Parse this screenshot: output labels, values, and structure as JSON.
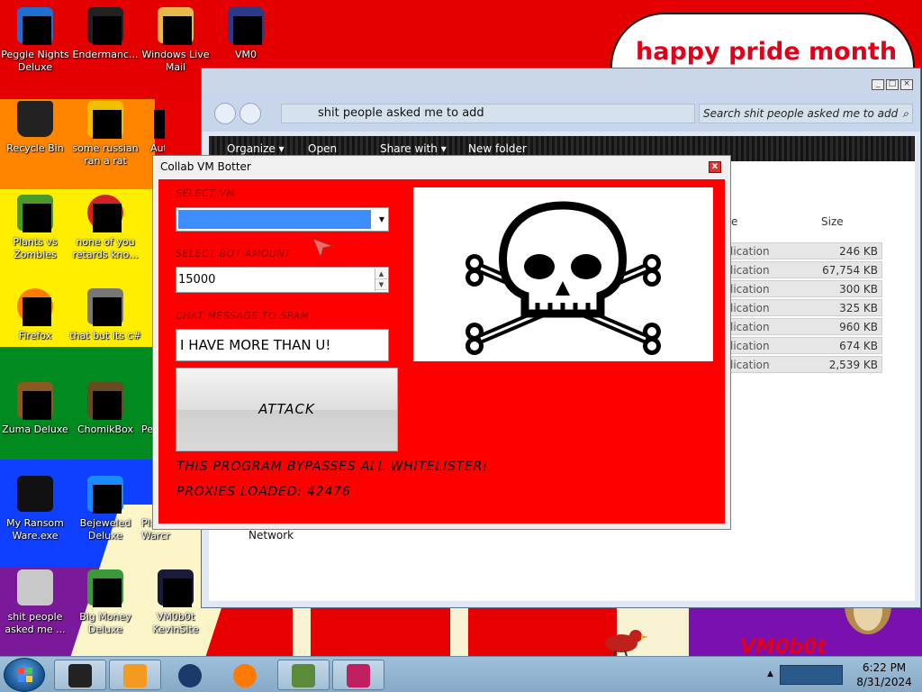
{
  "wallpaper": {
    "banner_text": "happy pride month",
    "brand_text": "VM0b0t"
  },
  "desktop_icons": [
    {
      "label": "Peggle Nights Deluxe",
      "icon": "peggle-icon",
      "color": "#1e6fd0"
    },
    {
      "label": "Endermanc...",
      "icon": "terminal-icon",
      "color": "#222222"
    },
    {
      "label": "Windows Live Mail",
      "icon": "mail-folder-icon",
      "color": "#e7b84a"
    },
    {
      "label": "VM0",
      "icon": "vm-icon",
      "color": "#2a3a8a"
    },
    {
      "label": "Recycle Bin",
      "icon": "recycle-bin-icon",
      "color": "#222222"
    },
    {
      "label": "some russian ran a rat",
      "icon": "ie-icon",
      "color": "#f0c000"
    },
    {
      "label": "Plants vs Zombies",
      "icon": "plant-icon",
      "color": "#4a9a2a"
    },
    {
      "label": "none of you retards kno...",
      "icon": "red-disc-icon",
      "color": "#d32020"
    },
    {
      "label": "Firefox",
      "icon": "firefox-icon",
      "color": "#ff7a00"
    },
    {
      "label": "that but its c#",
      "icon": "stack-icon",
      "color": "#777777"
    },
    {
      "label": "Zuma Deluxe",
      "icon": "zuma-icon",
      "color": "#8a5a20"
    },
    {
      "label": "ChomikBox",
      "icon": "chomik-icon",
      "color": "#6a4a20"
    },
    {
      "label": "My Ransom Ware.exe",
      "icon": "program-icon",
      "color": "#111111"
    },
    {
      "label": "Bejeweled Deluxe",
      "icon": "gem-icon",
      "color": "#1a8aff"
    },
    {
      "label": "shit people asked me ...",
      "icon": "folder-icon",
      "color": "#c8c8c8"
    },
    {
      "label": "Big Money Deluxe",
      "icon": "money-icon",
      "color": "#3a9a3a"
    },
    {
      "label": "VM0b0t KevinSite",
      "icon": "monitor-icon",
      "color": "#1a1a3a"
    }
  ],
  "partial_icon_labels": {
    "right_of_ie": "Auto F",
    "right_of_chomik": "Pe",
    "right_of_bejeweled": "Play of Warcr"
  },
  "explorer": {
    "address": "shit people asked me to add",
    "search_placeholder": "Search shit people asked me to add",
    "toolbar": [
      "Organize ▾",
      "Open",
      "Share with ▾",
      "New folder"
    ],
    "columns": {
      "type": "e",
      "size": "Size"
    },
    "files": [
      {
        "type": "lication",
        "size": "246 KB"
      },
      {
        "type": "lication",
        "size": "67,754 KB"
      },
      {
        "type": "lication",
        "size": "300 KB"
      },
      {
        "type": "lication",
        "size": "325 KB"
      },
      {
        "type": "lication",
        "size": "960 KB"
      },
      {
        "type": "lication",
        "size": "674 KB"
      },
      {
        "type": "lication",
        "size": "2,539 KB"
      }
    ],
    "nav_network": "Network"
  },
  "botter": {
    "title": "Collab VM Botter",
    "close": "x",
    "select_vm_label": "SELECT VM",
    "select_vm_value": "",
    "bot_amount_label": "SELECT BOT AMOUNT",
    "bot_amount_value": "15000",
    "chat_label": "CHAT MESSAGE TO SPAM",
    "chat_value": "I HAVE MORE THAN U!",
    "attack_label": "ATTACK",
    "note_bypass": "THIS PROGRAM BYPASSES ALL WHITELISTER!",
    "note_proxies": "PROXIES LOADED: 42476",
    "image_icon": "skull-crossbones-icon"
  },
  "taskbar": {
    "apps": [
      {
        "icon": "program-icon",
        "color": "#222222"
      },
      {
        "icon": "media-player-icon",
        "color": "#f39a20"
      },
      {
        "icon": "globe-icon",
        "color": "#1a3a6a"
      },
      {
        "icon": "firefox-icon",
        "color": "#ff7a00"
      },
      {
        "icon": "minecraft-icon",
        "color": "#5a8a3a"
      },
      {
        "icon": "image-viewer-icon",
        "color": "#c02060"
      }
    ],
    "time": "6:22 PM",
    "date": "8/31/2024"
  }
}
